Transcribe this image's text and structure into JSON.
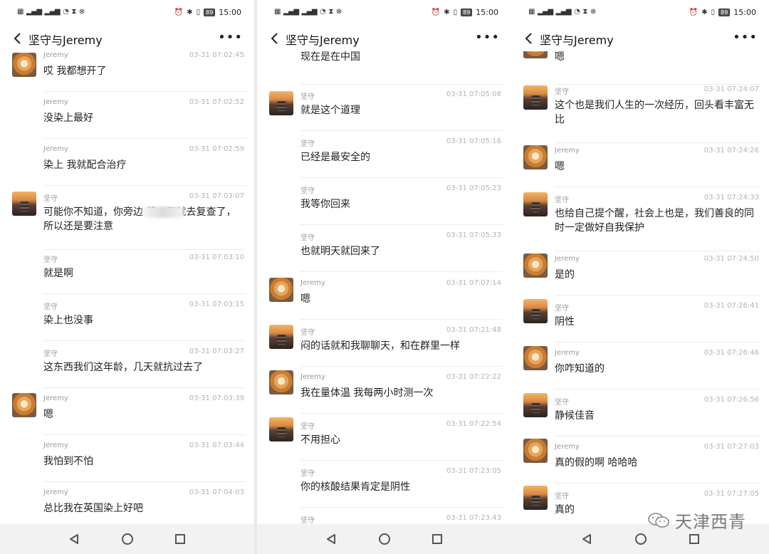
{
  "status": {
    "time": "15:00",
    "battery": "89"
  },
  "watermark": "天津西青",
  "screens": [
    {
      "title": "坚守与Jeremy",
      "messages": [
        {
          "sender": "Jeremy",
          "time": "03-31 07:02:45",
          "text": "哎 我都想开了",
          "avatar": "jeremy"
        },
        {
          "sender": "Jeremy",
          "time": "03-31 07:02:52",
          "text": "没染上最好",
          "avatar": ""
        },
        {
          "sender": "Jeremy",
          "time": "03-31 07:02:59",
          "text": "染上 我就配合治疗",
          "avatar": ""
        },
        {
          "sender": "坚守",
          "time": "03-31 07:03:07",
          "text": "可能你不知道，你旁边        第一天就去复查了，所以还是要注意",
          "avatar": "jianshou",
          "blur": true
        },
        {
          "sender": "坚守",
          "time": "03-31 07:03:10",
          "text": "就是啊",
          "avatar": ""
        },
        {
          "sender": "坚守",
          "time": "03-31 07:03:15",
          "text": "染上也没事",
          "avatar": ""
        },
        {
          "sender": "坚守",
          "time": "03-31 07:03:27",
          "text": "这东西我们这年龄，几天就抗过去了",
          "avatar": ""
        },
        {
          "sender": "Jeremy",
          "time": "03-31 07:03:39",
          "text": "嗯",
          "avatar": "jeremy"
        },
        {
          "sender": "Jeremy",
          "time": "03-31 07:03:44",
          "text": "我怕到不怕",
          "avatar": ""
        },
        {
          "sender": "Jeremy",
          "time": "03-31 07:04:03",
          "text": "总比我在英国染上好吧",
          "avatar": ""
        }
      ]
    },
    {
      "title": "坚守与Jeremy",
      "messages": [
        {
          "sender": "",
          "time": "",
          "text": "现在是在中国",
          "avatar": ""
        },
        {
          "sender": "坚守",
          "time": "03-31 07:05:08",
          "text": "就是这个道理",
          "avatar": "jianshou"
        },
        {
          "sender": "坚守",
          "time": "03-31 07:05:16",
          "text": "已经是最安全的",
          "avatar": ""
        },
        {
          "sender": "坚守",
          "time": "03-31 07:05:23",
          "text": "我等你回来",
          "avatar": ""
        },
        {
          "sender": "坚守",
          "time": "03-31 07:05:33",
          "text": "也就明天就回来了",
          "avatar": ""
        },
        {
          "sender": "Jeremy",
          "time": "03-31 07:07:14",
          "text": "嗯",
          "avatar": "jeremy"
        },
        {
          "sender": "坚守",
          "time": "03-31 07:21:48",
          "text": "闷的话就和我聊聊天，和在群里一样",
          "avatar": "jianshou"
        },
        {
          "sender": "Jeremy",
          "time": "03-31 07:22:22",
          "text": "我在量体温 我每两小时测一次",
          "avatar": "jeremy"
        },
        {
          "sender": "坚守",
          "time": "03-31 07:22:54",
          "text": "不用担心",
          "avatar": "jianshou"
        },
        {
          "sender": "坚守",
          "time": "03-31 07:23:05",
          "text": "你的核酸结果肯定是阴性",
          "avatar": ""
        },
        {
          "sender": "坚守",
          "time": "03-31 07:23:43",
          "text": "",
          "avatar": ""
        }
      ]
    },
    {
      "title": "坚守与Jeremy",
      "messages": [
        {
          "sender": "",
          "time": "",
          "text": "嗯",
          "avatar": "jeremy"
        },
        {
          "sender": "坚守",
          "time": "03-31 07:24:07",
          "text": "这个也是我们人生的一次经历，回头看丰富无比",
          "avatar": "jianshou"
        },
        {
          "sender": "Jeremy",
          "time": "03-31 07:24:26",
          "text": "嗯",
          "avatar": "jeremy"
        },
        {
          "sender": "坚守",
          "time": "03-31 07:24:33",
          "text": "也给自己提个醒，社会上也是，我们善良的同时一定做好自我保护",
          "avatar": "jianshou"
        },
        {
          "sender": "Jeremy",
          "time": "03-31 07:24:50",
          "text": "是的",
          "avatar": "jeremy"
        },
        {
          "sender": "坚守",
          "time": "03-31 07:26:41",
          "text": "阴性",
          "avatar": "jianshou"
        },
        {
          "sender": "Jeremy",
          "time": "03-31 07:26:46",
          "text": "你咋知道的",
          "avatar": "jeremy"
        },
        {
          "sender": "坚守",
          "time": "03-31 07:26:56",
          "text": "静候佳音",
          "avatar": "jianshou"
        },
        {
          "sender": "Jeremy",
          "time": "03-31 07:27:03",
          "text": "真的假的啊 哈哈哈",
          "avatar": "jeremy"
        },
        {
          "sender": "坚守",
          "time": "03-31 07:27:05",
          "text": "真的",
          "avatar": "jianshou"
        }
      ]
    }
  ]
}
